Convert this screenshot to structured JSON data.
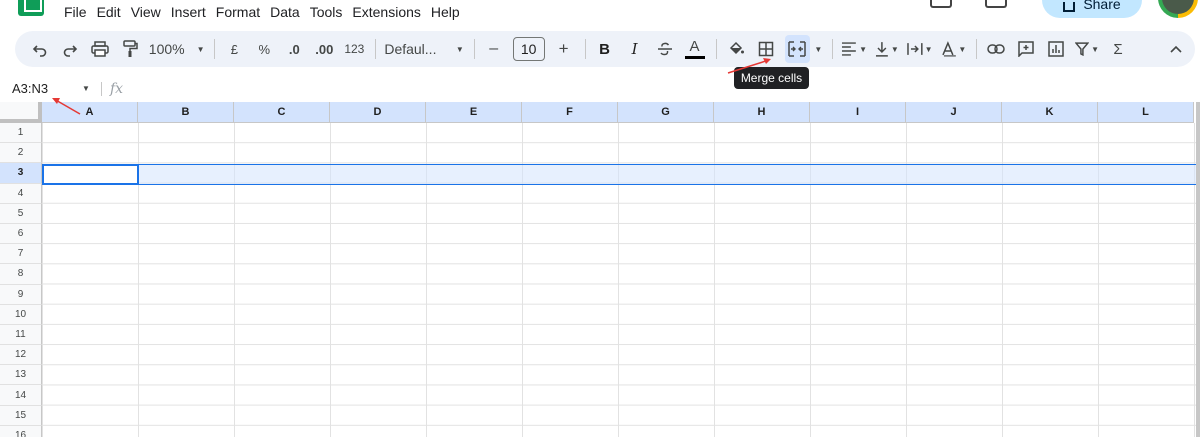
{
  "menu": [
    "File",
    "Edit",
    "View",
    "Insert",
    "Format",
    "Data",
    "Tools",
    "Extensions",
    "Help"
  ],
  "share_label": "Share",
  "toolbar": {
    "zoom": "100%",
    "currency": "£",
    "percent": "%",
    "decrease_decimal": ".0",
    "increase_decimal": ".00",
    "number_format": "123",
    "font": "Defaul...",
    "font_size": "10",
    "minus": "–",
    "plus": "+",
    "bold": "B",
    "italic": "I",
    "text_color_letter": "A",
    "sum": "Σ"
  },
  "tooltip": "Merge cells",
  "formula_bar": {
    "name_box": "A3:N3",
    "fx": "fx"
  },
  "grid": {
    "columns": [
      "A",
      "B",
      "C",
      "D",
      "E",
      "F",
      "G",
      "H",
      "I",
      "J",
      "K",
      "L"
    ],
    "rows": [
      "1",
      "2",
      "3",
      "4",
      "5",
      "6",
      "7",
      "8",
      "9",
      "10",
      "11",
      "12",
      "13",
      "14",
      "15",
      "16"
    ],
    "selected_row": "3"
  },
  "colors": {
    "accent": "#1a73e8",
    "selection": "#d3e3fd",
    "toolbar_bg": "#eef2f9",
    "annotation_arrow": "#e53935"
  }
}
